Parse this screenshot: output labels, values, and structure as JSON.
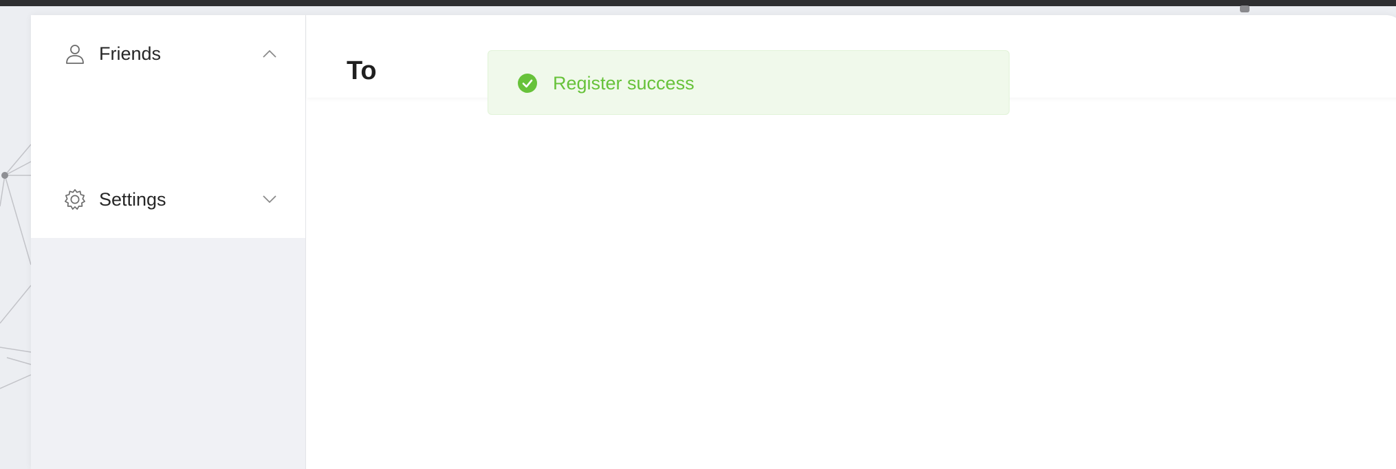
{
  "sidebar": {
    "items": [
      {
        "label": "Friends",
        "icon": "user-icon",
        "expanded": true
      },
      {
        "label": "Settings",
        "icon": "gear-icon",
        "expanded": false
      }
    ]
  },
  "header": {
    "title": "To"
  },
  "toast": {
    "message": "Register success",
    "icon": "check-circle-icon",
    "type": "success"
  },
  "colors": {
    "success_text": "#67c23a",
    "success_bg": "#f0f9eb",
    "success_border": "#e1f3d8",
    "sidebar_bg": "#f0f1f5"
  }
}
